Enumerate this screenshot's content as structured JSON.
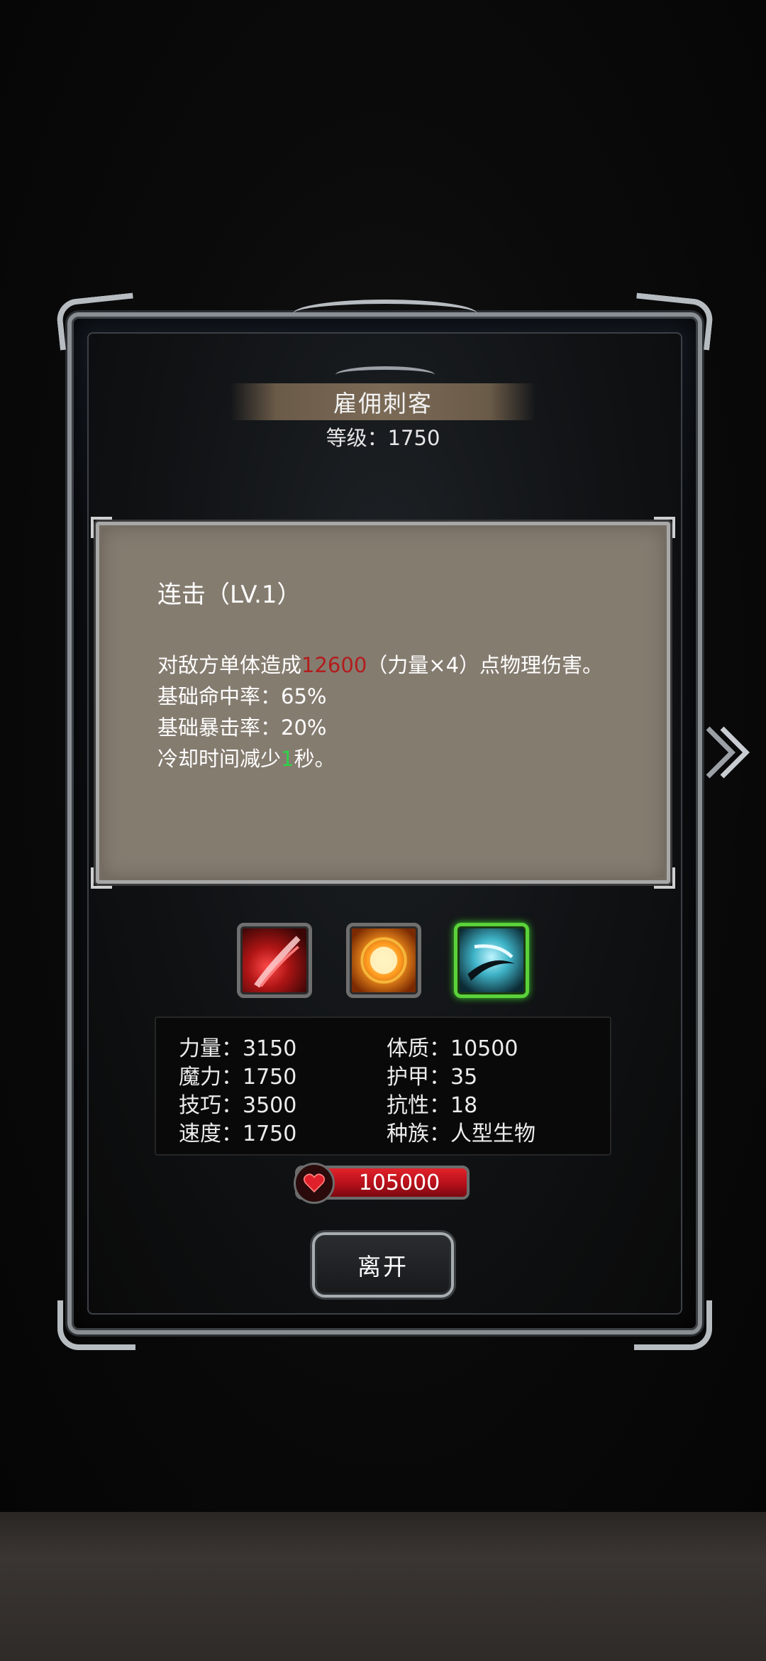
{
  "character": {
    "name": "雇佣刺客",
    "level_label": "等级：",
    "level_value": "1750"
  },
  "skill": {
    "name": "连击（LV.1）",
    "desc_prefix": "对敌方单体造成",
    "damage": "12600",
    "desc_suffix": "（力量×4）点物理伤害。",
    "hit_rate": "基础命中率：65%",
    "crit_rate": "基础暴击率：20%",
    "cooldown_prefix": "冷却时间减少",
    "cooldown_value": "1",
    "cooldown_suffix": "秒。"
  },
  "skill_icons": [
    {
      "icon": "red-slash-icon",
      "selected": false
    },
    {
      "icon": "fire-burst-icon",
      "selected": false
    },
    {
      "icon": "ice-slash-icon",
      "selected": true
    }
  ],
  "stats": {
    "strength": {
      "label": "力量：",
      "value": "3150"
    },
    "magic": {
      "label": "魔力：",
      "value": "1750"
    },
    "skill": {
      "label": "技巧：",
      "value": "3500"
    },
    "speed": {
      "label": "速度：",
      "value": "1750"
    },
    "constitution": {
      "label": "体质：",
      "value": "10500"
    },
    "armor": {
      "label": "护甲：",
      "value": "35"
    },
    "resistance": {
      "label": "抗性：",
      "value": "18"
    },
    "race": {
      "label": "种族：",
      "value": "人型生物"
    }
  },
  "hp": {
    "value": "105000",
    "icon": "heart-icon"
  },
  "buttons": {
    "leave": "离开"
  },
  "colors": {
    "damage": "#b21d1d",
    "cooldown": "#2fd14a",
    "hp_bar": "#c8141e",
    "selected_icon_border": "#5bd23a"
  }
}
